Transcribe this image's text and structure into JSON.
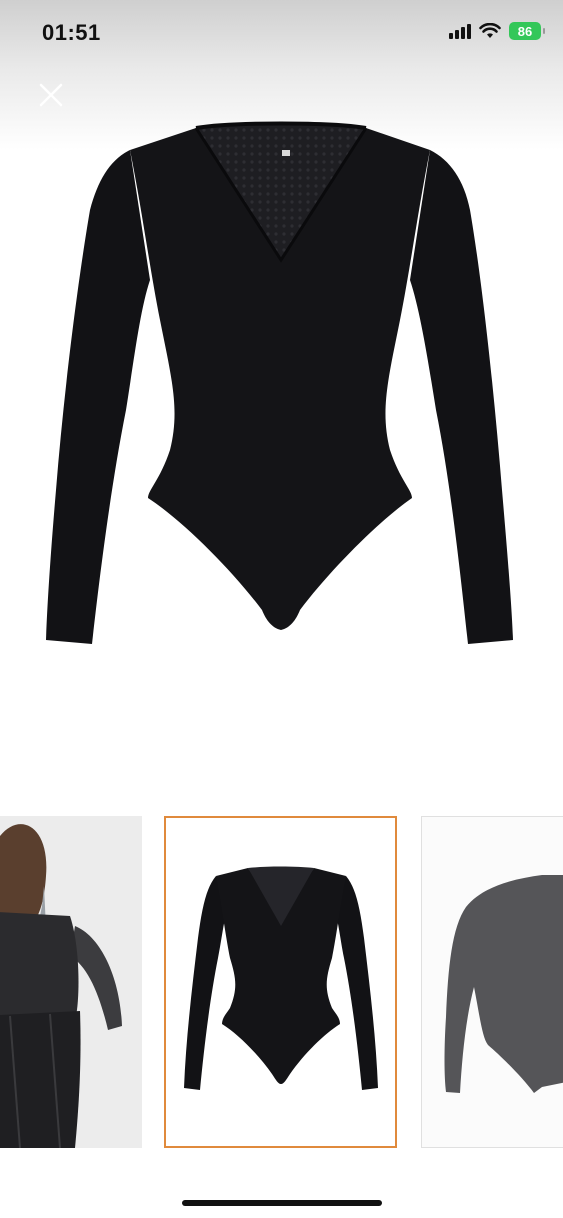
{
  "status_bar": {
    "time": "01:51",
    "battery_level": "86",
    "icons": [
      "cellular-signal-icon",
      "wifi-icon",
      "battery-icon"
    ]
  },
  "controls": {
    "close_icon": "close-icon"
  },
  "gallery": {
    "thumbnails": [
      {
        "name": "model-back-view",
        "selected": false
      },
      {
        "name": "black-bodysuit-front",
        "selected": true
      },
      {
        "name": "gray-bodysuit-side",
        "selected": false
      }
    ],
    "selected_border_color": "#e08a3c"
  },
  "colors": {
    "garment": "#111114",
    "battery": "#34c759"
  }
}
